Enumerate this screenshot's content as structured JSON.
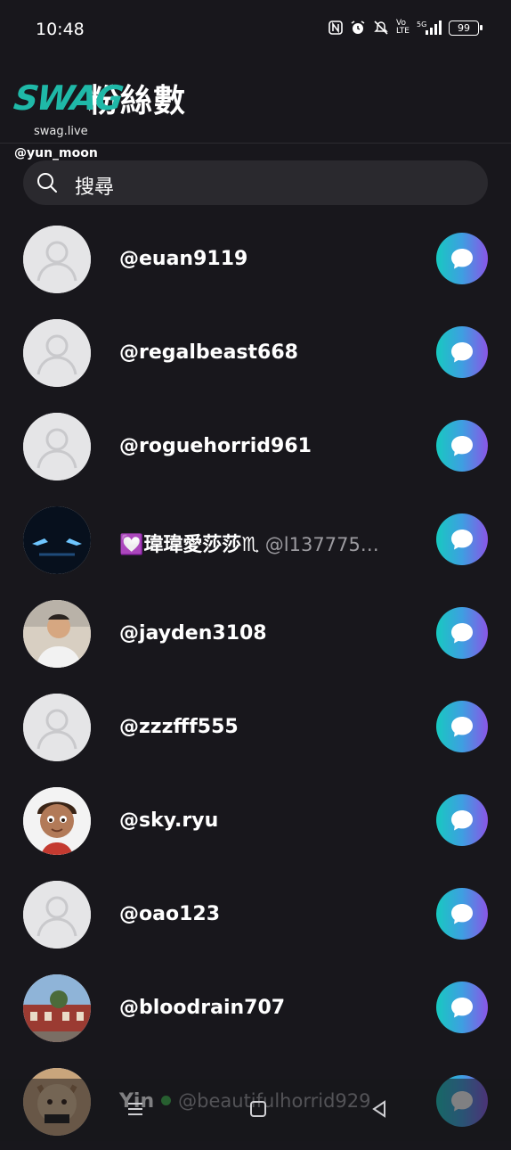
{
  "status": {
    "time": "10:48",
    "battery": "99",
    "icons": [
      "nfc-icon",
      "alarm-icon",
      "mute-icon",
      "volte-icon",
      "signal-5g-icon",
      "battery-icon"
    ]
  },
  "header": {
    "title": "粉絲數"
  },
  "watermark": {
    "logo": "SWAG",
    "site": "swag.live",
    "user": "@yun_moon"
  },
  "search": {
    "placeholder": "搜尋"
  },
  "followers": [
    {
      "name": "@euan9119",
      "handle": "",
      "avatar": "default"
    },
    {
      "name": "@regalbeast668",
      "handle": "",
      "avatar": "default"
    },
    {
      "name": "@roguehorrid961",
      "handle": "",
      "avatar": "default"
    },
    {
      "name": "💟瑋瑋愛莎莎♏",
      "handle": "@l137775…",
      "avatar": "dark-car"
    },
    {
      "name": "@jayden3108",
      "handle": "",
      "avatar": "photo-man"
    },
    {
      "name": "@zzzfff555",
      "handle": "",
      "avatar": "default"
    },
    {
      "name": "@sky.ryu",
      "handle": "",
      "avatar": "cartoon-boy"
    },
    {
      "name": "@oao123",
      "handle": "",
      "avatar": "default"
    },
    {
      "name": "@bloodrain707",
      "handle": "",
      "avatar": "photo-building"
    },
    {
      "name": "Yin",
      "handle": "@beautifulhorrid929",
      "avatar": "photo-cat",
      "online": true
    }
  ],
  "colors": {
    "background": "#18171c",
    "search_bg": "#2a292e",
    "gradient_start": "#17c9c0",
    "gradient_end": "#8a55e6",
    "online": "#3bb54a"
  }
}
